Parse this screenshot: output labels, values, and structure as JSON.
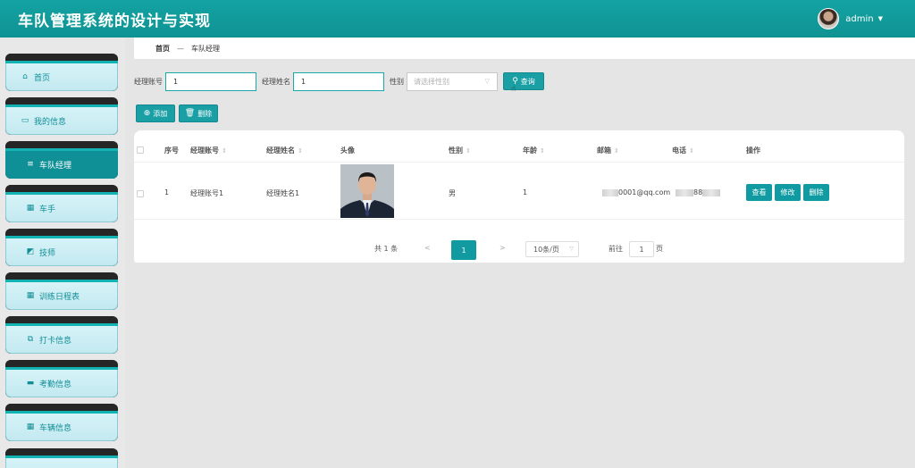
{
  "app": {
    "title": "车队管理系统的设计与实现"
  },
  "user": {
    "name": "admin"
  },
  "sidebar": {
    "items": [
      {
        "label": "首页",
        "icon": "home-icon",
        "glyph": "⌂"
      },
      {
        "label": "我的信息",
        "icon": "id-card-icon",
        "glyph": "▭"
      },
      {
        "label": "车队经理",
        "icon": "list-icon",
        "glyph": "≡",
        "active": true
      },
      {
        "label": "车手",
        "icon": "grid-icon",
        "glyph": "▦"
      },
      {
        "label": "技师",
        "icon": "chart-icon",
        "glyph": "◩"
      },
      {
        "label": "训练日程表",
        "icon": "grid-icon",
        "glyph": "▦"
      },
      {
        "label": "打卡信息",
        "icon": "clipboard-icon",
        "glyph": "⧉"
      },
      {
        "label": "考勤信息",
        "icon": "briefcase-icon",
        "glyph": "▬"
      },
      {
        "label": "车辆信息",
        "icon": "grid-icon",
        "glyph": "▦"
      }
    ]
  },
  "breadcrumb": {
    "home": "首页",
    "sep": "—",
    "current": "车队经理"
  },
  "search": {
    "account_label": "经理账号",
    "account_value": "1",
    "name_label": "经理姓名",
    "name_value": "1",
    "gender_label": "性别",
    "gender_placeholder": "请选择性别",
    "query_label": "查询"
  },
  "actions": {
    "add_label": "添加",
    "delete_label": "删除"
  },
  "table": {
    "headers": {
      "index": "序号",
      "account": "经理账号",
      "name": "经理姓名",
      "avatar": "头像",
      "gender": "性别",
      "age": "年龄",
      "email": "邮箱",
      "phone": "电话",
      "ops": "操作"
    },
    "rows": [
      {
        "index": "1",
        "account": "经理账号1",
        "name": "经理姓名1",
        "gender": "男",
        "age": "1",
        "email": "0001@qq.com",
        "phone": "88",
        "view_label": "查看",
        "edit_label": "修改",
        "delete_label": "删除"
      }
    ]
  },
  "pagination": {
    "total": "共 1 条",
    "prev": "<",
    "current": "1",
    "next": ">",
    "page_size": "10条/页",
    "goto_label": "前往",
    "goto_value": "1",
    "page_unit": "页"
  },
  "colors": {
    "topbar": "#14a3a3",
    "accent": "#109ba2"
  }
}
